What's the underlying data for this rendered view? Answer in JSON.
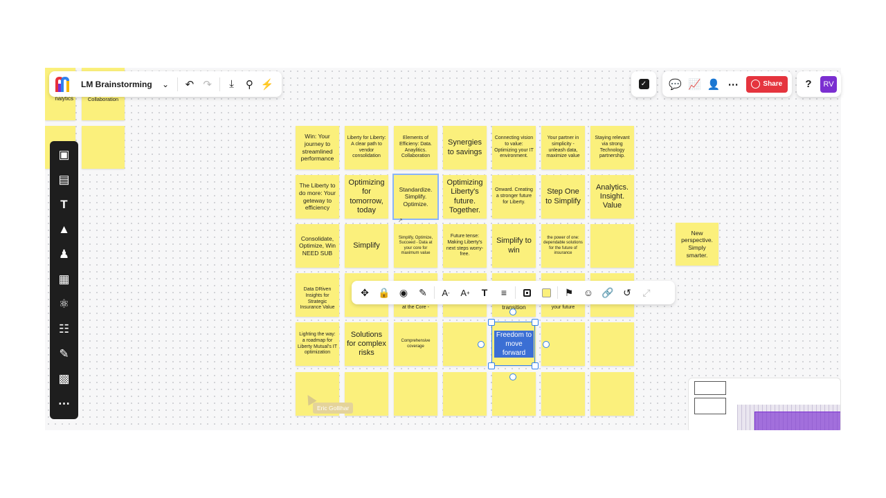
{
  "app": {
    "board_title": "LM Brainstorming"
  },
  "toolbar_top": {
    "dropdown_icon": "chevron-down-icon",
    "undo_icon": "undo-icon",
    "redo_icon": "redo-icon",
    "export_icon": "download-icon",
    "search_icon": "search-icon",
    "lightning_icon": "lightning-icon"
  },
  "right_bar": {
    "share_label": "Share",
    "avatar_initials": "RV",
    "share_color": "#e5343e",
    "avatar_color": "#7b2fd1"
  },
  "edge_notes": [
    "nalytics",
    "Collaboration"
  ],
  "notes": [
    [
      "Win: Your journey to streamlined performance",
      "Liberty for Liberty: A clear path to vendor consolidation",
      "Elements of Efficieny: Data. Anaylitics. Collaboration",
      "Synergies to savings",
      "Connecting vision to value: Optimizing your IT environment.",
      "Your partner in simplicity - unleash data, maximize value",
      "Staying relevant via strong Technology partnership."
    ],
    [
      "The Liberty to do more: Your geteway to efficiency",
      "Optimizing for tomorrow, today",
      "Standardize. Simplify. Optimize.",
      "Optimizing Liberty's future. Together.",
      "Onward. Creating a stronger future for Liberty.",
      "Step One to Simplify",
      "Analytics. Insight. Value"
    ],
    [
      "Consolidate, Optimize, Win NEED SUB",
      "Simplify",
      "Simplify, Optimize, Succeed - Data at your core for maximum value",
      "Future tense: Making Liberty's next steps worry-free.",
      "Simplify to win",
      "the power of one: dependable solutions for the future of insurance",
      ""
    ],
    [
      "Data DRiven Insights for Strategic Insurance Value",
      "",
      "at the Core -",
      "",
      "transition",
      "your future",
      ""
    ],
    [
      "Lighting the way: a roadmap for Liberty Mutual's IT optimization",
      "Solutions for complex risks",
      "Comprehensive coverage",
      "",
      "Freedom to move forward",
      "",
      ""
    ],
    [
      "",
      "",
      "",
      "",
      "",
      "",
      ""
    ]
  ],
  "side_note": "New perspective. Simply smarter.",
  "cursor_label": "Eric Gollihar",
  "sidebar_icons": [
    "templates-icon",
    "sticky-note-icon",
    "text-icon",
    "shapes-icon",
    "llama-icon",
    "image-icon",
    "mind-map-icon",
    "table-icon",
    "pen-icon",
    "frame-icon",
    "more-icon"
  ],
  "context_toolbar_icons": [
    "move-icon",
    "lock-icon",
    "hide-icon",
    "pen-icon",
    "font-decrease-icon",
    "font-increase-icon",
    "text-format-icon",
    "align-icon",
    "border-icon",
    "fill-color-icon",
    "tag-icon",
    "add-reaction-icon",
    "link-icon",
    "convert-icon",
    "expand-icon"
  ],
  "colors": {
    "sticky": "#fbf07c",
    "selection": "#2f80ed",
    "sidebar_bg": "#1e1e1e"
  }
}
